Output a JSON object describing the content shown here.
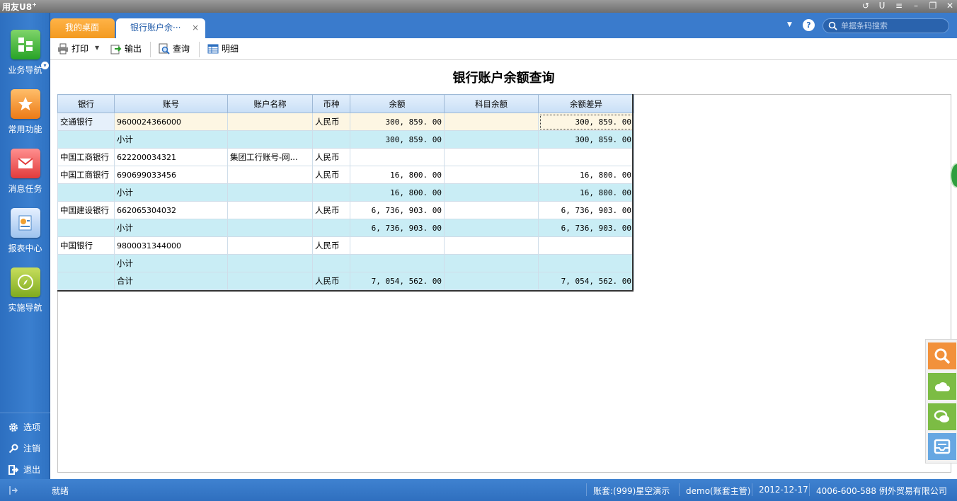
{
  "app": {
    "logo": "用友",
    "logo_u8": "U8",
    "logo_sup": "+"
  },
  "window_controls": [
    "↺",
    "U",
    "≡",
    "–",
    "❐",
    "✕"
  ],
  "sidebar": {
    "items": [
      {
        "label": "业务导航",
        "icon": "business-nav-icon"
      },
      {
        "label": "常用功能",
        "icon": "star-icon"
      },
      {
        "label": "消息任务",
        "icon": "mail-icon"
      },
      {
        "label": "报表中心",
        "icon": "report-icon"
      },
      {
        "label": "实施导航",
        "icon": "compass-icon"
      }
    ],
    "bottom": [
      {
        "label": "选项",
        "icon": "gear-icon"
      },
      {
        "label": "注销",
        "icon": "key-icon"
      },
      {
        "label": "退出",
        "icon": "exit-icon"
      }
    ]
  },
  "tabs": [
    {
      "label": "我的桌面"
    },
    {
      "label": "银行账户余···",
      "close": "×"
    }
  ],
  "search": {
    "placeholder": "单据条码搜索"
  },
  "toolbar": {
    "print": "打印",
    "export": "输出",
    "query": "查询",
    "detail": "明细"
  },
  "report": {
    "title": "银行账户余额查询",
    "columns": [
      "银行",
      "账号",
      "账户名称",
      "币种",
      "余额",
      "科目余额",
      "余额差异"
    ],
    "rows": [
      {
        "bank": "交通银行",
        "account": "9600024366000",
        "name": "",
        "currency": "人民币",
        "balance": "300, 859. 00",
        "subject_balance": "",
        "diff": "300, 859. 00"
      },
      {
        "bank": "",
        "account": "小计",
        "name": "",
        "currency": "",
        "balance": "300, 859. 00",
        "subject_balance": "",
        "diff": "300, 859. 00"
      },
      {
        "bank": "中国工商银行",
        "account": "622200034321",
        "name": "集团工行账号-网...",
        "currency": "人民币",
        "balance": "",
        "subject_balance": "",
        "diff": ""
      },
      {
        "bank": "中国工商银行",
        "account": "690699033456",
        "name": "",
        "currency": "人民币",
        "balance": "16, 800. 00",
        "subject_balance": "",
        "diff": "16, 800. 00"
      },
      {
        "bank": "",
        "account": "小计",
        "name": "",
        "currency": "",
        "balance": "16, 800. 00",
        "subject_balance": "",
        "diff": "16, 800. 00"
      },
      {
        "bank": "中国建设银行",
        "account": "662065304032",
        "name": "",
        "currency": "人民币",
        "balance": "6, 736, 903. 00",
        "subject_balance": "",
        "diff": "6, 736, 903. 00"
      },
      {
        "bank": "",
        "account": "小计",
        "name": "",
        "currency": "",
        "balance": "6, 736, 903. 00",
        "subject_balance": "",
        "diff": "6, 736, 903. 00"
      },
      {
        "bank": "中国银行",
        "account": "9800031344000",
        "name": "",
        "currency": "人民币",
        "balance": "",
        "subject_balance": "",
        "diff": ""
      },
      {
        "bank": "",
        "account": "小计",
        "name": "",
        "currency": "",
        "balance": "",
        "subject_balance": "",
        "diff": ""
      },
      {
        "bank": "",
        "account": "合计",
        "name": "",
        "currency": "人民币",
        "balance": "7, 054, 562. 00",
        "subject_balance": "",
        "diff": "7, 054, 562. 00"
      }
    ]
  },
  "statusbar": {
    "left": "就绪",
    "account_set": "账套:(999)星空演示",
    "user": "demo(账套主管)",
    "date": "2012-12-17",
    "company": "4006-600-588 例外贸易有限公司"
  }
}
